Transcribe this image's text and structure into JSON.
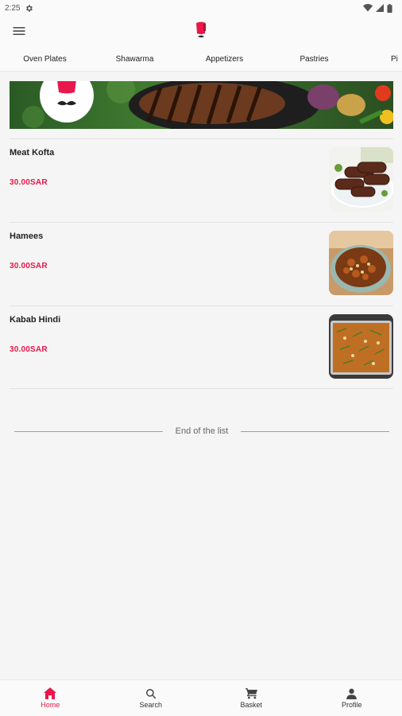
{
  "status_bar": {
    "time": "2:25"
  },
  "tabs": [
    {
      "label": "Oven Plates",
      "active": true
    },
    {
      "label": "Shawarma",
      "active": false
    },
    {
      "label": "Appetizers",
      "active": false
    },
    {
      "label": "Pastries",
      "active": false
    },
    {
      "label": "Pi",
      "active": false
    }
  ],
  "menu_items": [
    {
      "name": "Meat Kofta",
      "price": "30.00SAR",
      "image_icon": "meat-kofta-photo"
    },
    {
      "name": "Hamees",
      "price": "30.00SAR",
      "image_icon": "hamees-photo"
    },
    {
      "name": "Kabab Hindi",
      "price": "30.00SAR",
      "image_icon": "kabab-hindi-photo"
    }
  ],
  "end_of_list": {
    "text": "End of the list"
  },
  "bottom_nav": [
    {
      "label": "Home",
      "icon": "home-icon",
      "active": true
    },
    {
      "label": "Search",
      "icon": "search-icon",
      "active": false
    },
    {
      "label": "Basket",
      "icon": "cart-icon",
      "active": false
    },
    {
      "label": "Profile",
      "icon": "person-icon",
      "active": false
    }
  ],
  "colors": {
    "accent": "#e8184a",
    "tab_indicator": "#f7a5ad",
    "background": "#f5f5f5"
  }
}
